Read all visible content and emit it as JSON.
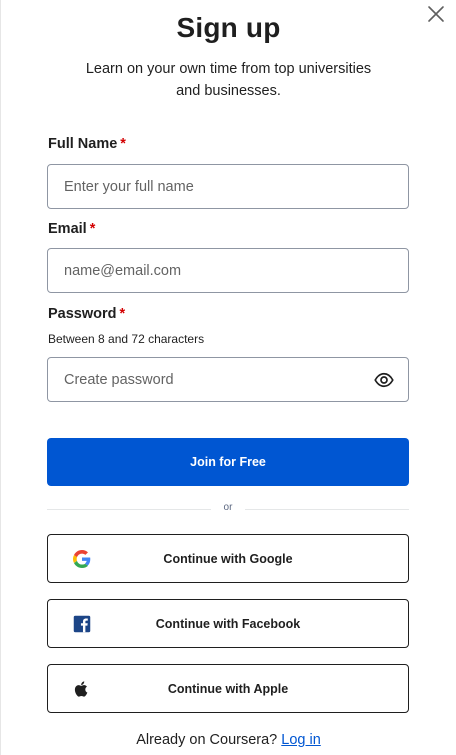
{
  "header": {
    "title": "Sign up",
    "subtitle": "Learn on your own time from top universities and businesses."
  },
  "form": {
    "full_name": {
      "label": "Full Name",
      "required_mark": "*",
      "placeholder": "Enter your full name",
      "value": ""
    },
    "email": {
      "label": "Email",
      "required_mark": "*",
      "placeholder": "name@email.com",
      "value": ""
    },
    "password": {
      "label": "Password",
      "required_mark": "*",
      "hint": "Between 8 and 72 characters",
      "placeholder": "Create password",
      "value": ""
    },
    "submit_label": "Join for Free"
  },
  "divider_text": "or",
  "social": {
    "google": {
      "label": "Continue with Google",
      "icon": "google-icon"
    },
    "facebook": {
      "label": "Continue with Facebook",
      "icon": "facebook-icon"
    },
    "apple": {
      "label": "Continue with Apple",
      "icon": "apple-icon"
    }
  },
  "footer": {
    "prompt": "Already on Coursera?",
    "login_label": "Log in"
  },
  "colors": {
    "primary": "#0056d2",
    "required": "#d30001",
    "facebook": "#1c4587"
  }
}
